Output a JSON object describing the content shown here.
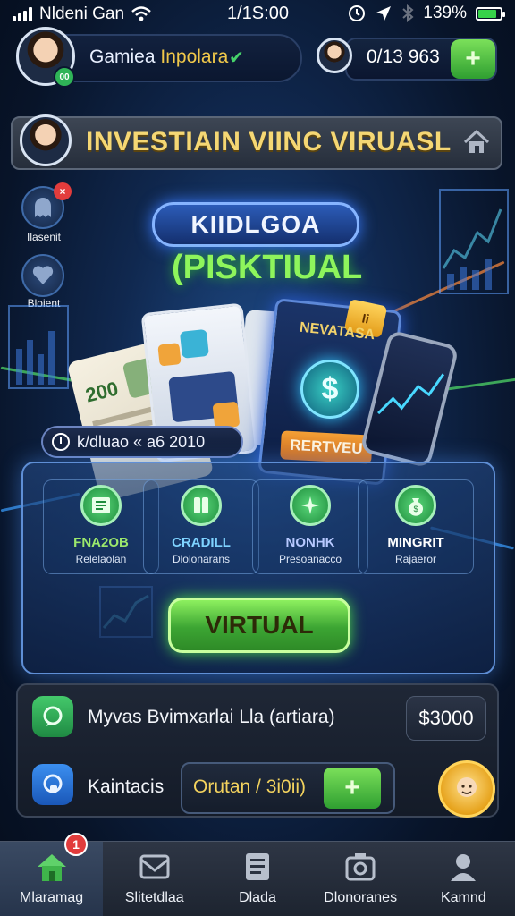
{
  "status_bar": {
    "carrier": "Nldeni Gan",
    "time": "1/1S:00",
    "battery_percent": "139%",
    "battery_level": 0.85
  },
  "header": {
    "username_prefix": "Gamiea",
    "username_accent": "Inpolara",
    "verified_icon": "check-icon",
    "level_badge": "00",
    "balance": "0/13 963",
    "add_icon": "plus-icon"
  },
  "title_bar": {
    "title": "INVESTIAIN VIINC VIRUASL",
    "home_icon": "home-icon"
  },
  "side_widgets": [
    {
      "label": "Ilasenit",
      "icon": "ghost-icon",
      "badge": ""
    },
    {
      "label": "Bloient",
      "icon": "heart-icon"
    }
  ],
  "hero": {
    "top_label": "KIIDLGOA",
    "sub_label": "(PISKTIUAL"
  },
  "cards": {
    "bill_value": "200",
    "vault_title": "NEVATASA",
    "vault_coin": "$",
    "vault_button": "RERTVEU",
    "tag": "Ii"
  },
  "timer": {
    "text": "k/dluao « a6 2010"
  },
  "options": [
    {
      "title": "FNA2OB",
      "subtitle": "Relelaolan",
      "icon": "list-icon"
    },
    {
      "title": "CRADILL",
      "subtitle": "Dlolonarans",
      "icon": "split-icon"
    },
    {
      "title": "NONHK",
      "subtitle": "Presoanacco",
      "icon": "sparkle-icon"
    },
    {
      "title": "MINGRIT",
      "subtitle": "Rajaeror",
      "icon": "money-bag-icon"
    }
  ],
  "primary_button": "VIRTUAL",
  "info_rows": {
    "row1_text": "Myvas Bvimxarlai Lla (artiara)",
    "row1_amount": "$3000",
    "row2_label": "Kaintacis",
    "row2_field": "Orutan / 3i0ii)",
    "row2_add_icon": "plus-icon"
  },
  "bottom_nav": [
    {
      "label": "Mlaramag",
      "icon": "home-icon",
      "active": true,
      "badge": "1"
    },
    {
      "label": "Slitetdlaa",
      "icon": "inbox-icon",
      "active": false
    },
    {
      "label": "Dlada",
      "icon": "list-icon",
      "active": false
    },
    {
      "label": "Dlonoranes",
      "icon": "camera-icon",
      "active": false
    },
    {
      "label": "Kamnd",
      "icon": "user-icon",
      "active": false
    }
  ],
  "colors": {
    "accent_gold": "#f5d774",
    "accent_green": "#8ef55c",
    "button_green": "#3ca533",
    "background": "#10284f"
  }
}
